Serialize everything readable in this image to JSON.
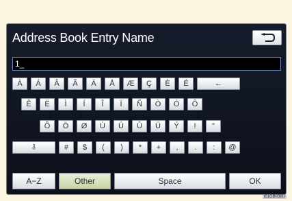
{
  "header": {
    "title": "Address Book Entry Name",
    "back_icon": "return-arrow-icon"
  },
  "input": {
    "value": "1_"
  },
  "keyboard": {
    "row1": [
      "À",
      "Á",
      "Â",
      "Ã",
      "Ä",
      "Å",
      "Æ",
      "Ç",
      "È",
      "É",
      "←"
    ],
    "row2": [
      "Ê",
      "Ë",
      "Ì",
      "Í",
      "Î",
      "Ï",
      "Ñ",
      "Ò",
      "Ó",
      "Ô"
    ],
    "row3": [
      "Õ",
      "Ö",
      "Ø",
      "Ù",
      "Ú",
      "Û",
      "Ü",
      "Ý",
      "!",
      "\""
    ],
    "row4": [
      "⇩",
      "#",
      "$",
      "(",
      ")",
      "*",
      "+",
      ",",
      ".",
      ":",
      "@"
    ]
  },
  "function_keys": {
    "az": "A−Z",
    "other": "Other",
    "space": "Space",
    "ok": "OK"
  },
  "footer": {
    "code": "I51GB038U"
  }
}
